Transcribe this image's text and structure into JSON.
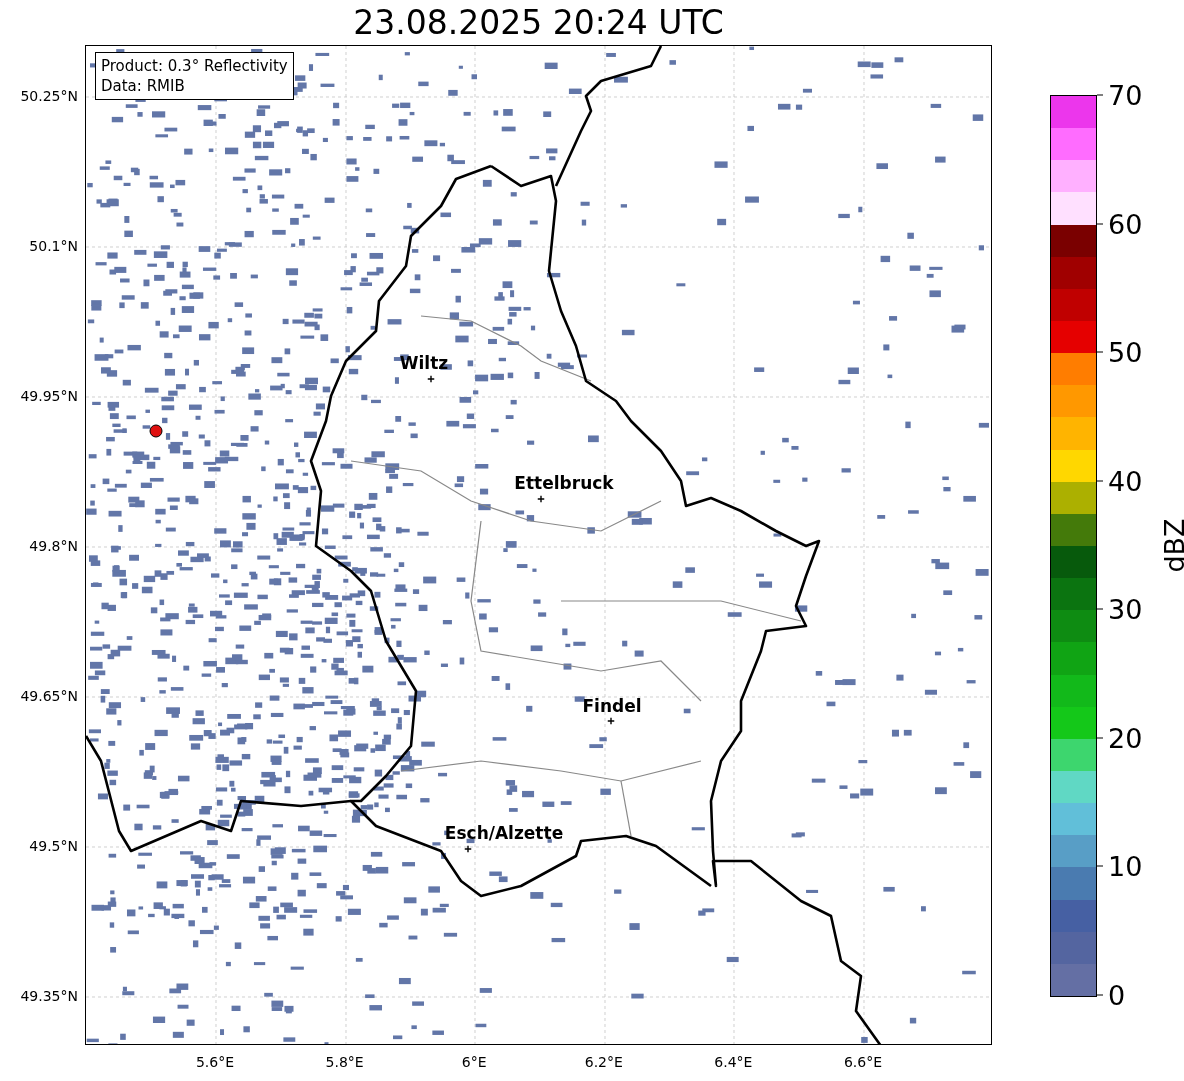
{
  "title": "23.08.2025 20:24 UTC",
  "info_box": {
    "lines": [
      "Product: 0.3° Reflectivity",
      "Data: RMIB"
    ]
  },
  "map": {
    "lat_ticks": [
      "50.25°N",
      "50.1°N",
      "49.95°N",
      "49.8°N",
      "49.65°N",
      "49.5°N",
      "49.35°N"
    ],
    "lon_ticks": [
      "5.6°E",
      "5.8°E",
      "6°E",
      "6.2°E",
      "6.4°E",
      "6.6°E"
    ],
    "cities": [
      {
        "name": "Wiltz"
      },
      {
        "name": "Ettelbruck"
      },
      {
        "name": "Findel"
      },
      {
        "name": "Esch/Alzette"
      }
    ]
  },
  "colorbar": {
    "label": "dBZ",
    "ticks": [
      "70",
      "60",
      "50",
      "40",
      "30",
      "20",
      "10",
      "0"
    ],
    "bands": [
      {
        "color": "#ec36ec"
      },
      {
        "color": "#ff6cff"
      },
      {
        "color": "#ffb0ff"
      },
      {
        "color": "#ffe0ff"
      },
      {
        "color": "#7a0000"
      },
      {
        "color": "#a00000"
      },
      {
        "color": "#c00000"
      },
      {
        "color": "#e50000"
      },
      {
        "color": "#ff7d00"
      },
      {
        "color": "#ff9800"
      },
      {
        "color": "#ffb400"
      },
      {
        "color": "#ffd700"
      },
      {
        "color": "#acb000"
      },
      {
        "color": "#447a0a"
      },
      {
        "color": "#075a0c"
      },
      {
        "color": "#0b7410"
      },
      {
        "color": "#0e8c12"
      },
      {
        "color": "#10a414"
      },
      {
        "color": "#12b91a"
      },
      {
        "color": "#14c819"
      },
      {
        "color": "#3dd66e"
      },
      {
        "color": "#60d8c4"
      },
      {
        "color": "#61bfd9"
      },
      {
        "color": "#589ec6"
      },
      {
        "color": "#4a7bb0"
      },
      {
        "color": "#4660a3"
      },
      {
        "color": "#5465a0"
      },
      {
        "color": "#646fa4"
      }
    ]
  }
}
